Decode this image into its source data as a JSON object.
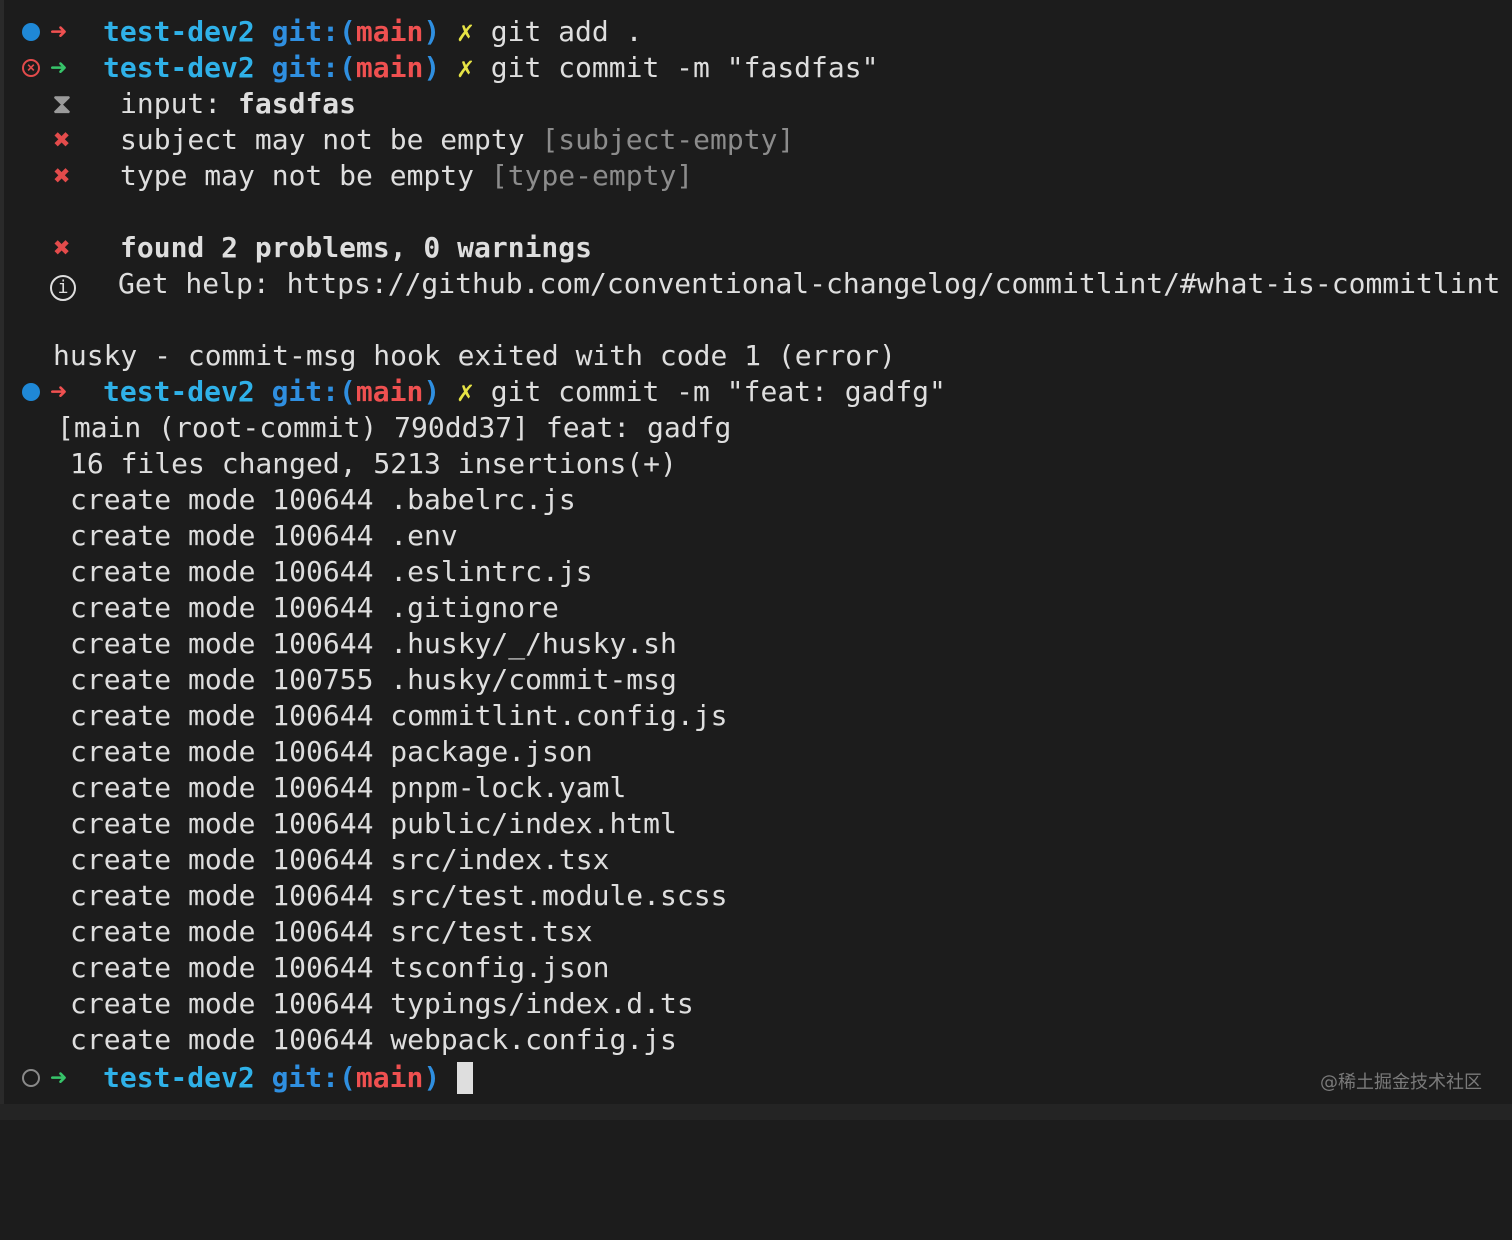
{
  "colors": {
    "background": "#1c1c1c",
    "text": "#dedede",
    "dir": "#2fb1e8",
    "git": "#2f8fe0",
    "branch": "#ef5050",
    "dirty": "#e6e345",
    "success_arrow": "#37c46a",
    "error": "#e34b4b",
    "dim": "#8c8c8c"
  },
  "prompt": {
    "dir": "test-dev2",
    "git_open": "git:(",
    "branch": "main",
    "git_close": ")",
    "dirty": "✗",
    "arrow": "➜"
  },
  "commands": {
    "cmd1": "git add .",
    "cmd2": "git commit -m \"fasdfas\"",
    "cmd3": "git commit -m \"feat: gadfg\""
  },
  "lint": {
    "input_label": "input: ",
    "input_value": "fasdfas",
    "errors": [
      {
        "text": "subject may not be empty ",
        "rule": "[subject-empty]"
      },
      {
        "text": "type may not be empty ",
        "rule": "[type-empty]"
      }
    ],
    "summary": "found 2 problems, 0 warnings",
    "help": "Get help: https://github.com/conventional-changelog/commitlint/#what-is-commitlint",
    "hook_error": "husky - commit-msg hook exited with code 1 (error)",
    "icons": {
      "input": "⧗",
      "error": "✖",
      "info": "ⓘ"
    }
  },
  "commit_output": {
    "header": "[main (root-commit) 790dd37] feat: gadfg",
    "stats": "16 files changed, 5213 insertions(+)",
    "files": [
      "create mode 100644 .babelrc.js",
      "create mode 100644 .env",
      "create mode 100644 .eslintrc.js",
      "create mode 100644 .gitignore",
      "create mode 100644 .husky/_/husky.sh",
      "create mode 100755 .husky/commit-msg",
      "create mode 100644 commitlint.config.js",
      "create mode 100644 package.json",
      "create mode 100644 pnpm-lock.yaml",
      "create mode 100644 public/index.html",
      "create mode 100644 src/index.tsx",
      "create mode 100644 src/test.module.scss",
      "create mode 100644 src/test.tsx",
      "create mode 100644 tsconfig.json",
      "create mode 100644 typings/index.d.ts",
      "create mode 100644 webpack.config.js"
    ]
  },
  "watermark": "@稀土掘金技术社区"
}
